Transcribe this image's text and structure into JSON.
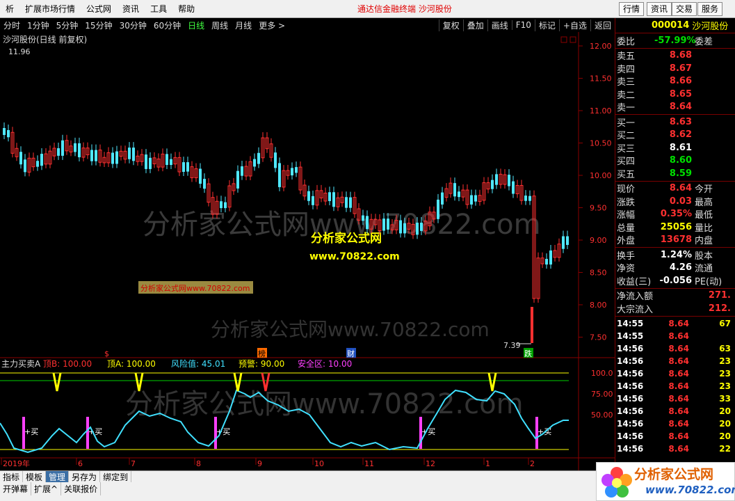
{
  "menu": {
    "items": [
      "析",
      "扩展市场行情",
      "公式网",
      "资讯",
      "工具",
      "帮助"
    ],
    "center": "通达信金融终端   沙河股份",
    "right_buttons": [
      "行情",
      "资讯",
      "交易",
      "服务"
    ]
  },
  "periods": {
    "items": [
      "分时",
      "1分钟",
      "5分钟",
      "15分钟",
      "30分钟",
      "60分钟",
      "日线",
      "周线",
      "月线",
      "更多 >"
    ],
    "active": "日线",
    "tools": [
      "复权",
      "叠加",
      "画线",
      "F10",
      "标记",
      "+自选",
      "返回"
    ]
  },
  "main_chart": {
    "title": "沙河股份(日线 前复权)",
    "high_label": "11.96",
    "low_label": "7.39",
    "y_ticks": [
      "12.00",
      "11.50",
      "11.00",
      "10.50",
      "10.00",
      "9.50",
      "9.00",
      "8.50",
      "8.00",
      "7.50"
    ],
    "markers": [
      "$",
      "榜",
      "财",
      "跌"
    ],
    "watermark_big": "分析家公式网www.70822.com",
    "watermark_small": "分析家公式网www.70822.com",
    "watermark_cn": "分析家公式网",
    "watermark_url": "www.70822.com",
    "colors": {
      "up": "#ff3030",
      "down": "#50e8ff",
      "bg": "#000000"
    }
  },
  "indicator": {
    "name": "主力买卖A",
    "fields": [
      {
        "label": "顶B:",
        "value": "100.00",
        "color": "#ff3030"
      },
      {
        "label": "顶A:",
        "value": "100.00",
        "color": "#ffff00"
      },
      {
        "label": "风险值:",
        "value": "45.01",
        "color": "#40e0ff"
      },
      {
        "label": "预警:",
        "value": "90.00",
        "color": "#ffff00"
      },
      {
        "label": "安全区:",
        "value": "10.00",
        "color": "#ff40ff"
      }
    ],
    "y_ticks": [
      "100.0",
      "75.00",
      "50.00"
    ],
    "buy_label": "+买",
    "buy_marks": 5
  },
  "x_axis": {
    "labels": [
      "2019年",
      "6",
      "7",
      "8",
      "9",
      "10",
      "11",
      "12",
      "1",
      "2"
    ]
  },
  "quote": {
    "code": "000014",
    "name": "沙河股份",
    "weibi_label": "委比",
    "weibi_value": "-57.99%",
    "weicha_label": "委差",
    "asks": [
      {
        "label": "卖五",
        "price": "8.68"
      },
      {
        "label": "卖四",
        "price": "8.67"
      },
      {
        "label": "卖三",
        "price": "8.66"
      },
      {
        "label": "卖二",
        "price": "8.65"
      },
      {
        "label": "卖一",
        "price": "8.64"
      }
    ],
    "bids": [
      {
        "label": "买一",
        "price": "8.63",
        "cls": "red"
      },
      {
        "label": "买二",
        "price": "8.62",
        "cls": "red"
      },
      {
        "label": "买三",
        "price": "8.61",
        "cls": "white"
      },
      {
        "label": "买四",
        "price": "8.60",
        "cls": "green"
      },
      {
        "label": "买五",
        "price": "8.59",
        "cls": "green"
      }
    ],
    "stats1": [
      {
        "label": "现价",
        "value": "8.64",
        "cls": "red",
        "label2": "今开"
      },
      {
        "label": "涨跌",
        "value": "0.03",
        "cls": "red",
        "label2": "最高"
      },
      {
        "label": "涨幅",
        "value": "0.35%",
        "cls": "red",
        "label2": "最低"
      },
      {
        "label": "总量",
        "value": "25056",
        "cls": "yellow",
        "label2": "量比"
      },
      {
        "label": "外盘",
        "value": "13678",
        "cls": "red",
        "label2": "内盘"
      }
    ],
    "stats2": [
      {
        "label": "换手",
        "value": "1.24%",
        "cls": "white",
        "label2": "股本"
      },
      {
        "label": "净资",
        "value": "4.26",
        "cls": "white",
        "label2": "流通"
      },
      {
        "label": "收益(三)",
        "value": "-0.056",
        "cls": "white",
        "label2": "PE(动)"
      }
    ],
    "flows": [
      {
        "label": "净流入额",
        "value": "271."
      },
      {
        "label": "大宗流入",
        "value": "212."
      }
    ],
    "ticks": [
      {
        "t": "14:55",
        "p": "8.64",
        "q": "67"
      },
      {
        "t": "14:55",
        "p": "8.64",
        "q": ""
      },
      {
        "t": "14:56",
        "p": "8.64",
        "q": "63"
      },
      {
        "t": "14:56",
        "p": "8.64",
        "q": "23"
      },
      {
        "t": "14:56",
        "p": "8.64",
        "q": "23"
      },
      {
        "t": "14:56",
        "p": "8.64",
        "q": "23"
      },
      {
        "t": "14:56",
        "p": "8.64",
        "q": "33"
      },
      {
        "t": "14:56",
        "p": "8.64",
        "q": "20"
      },
      {
        "t": "14:56",
        "p": "8.64",
        "q": "20"
      },
      {
        "t": "14:56",
        "p": "8.64",
        "q": "20"
      },
      {
        "t": "14:56",
        "p": "8.64",
        "q": "22"
      }
    ]
  },
  "bottom": {
    "row1": [
      "指标",
      "模板",
      "管理",
      "另存为",
      "绑定到"
    ],
    "row1_active": "管理",
    "row2": [
      "开弹幕",
      "扩展^",
      "关联报价"
    ]
  },
  "logo": {
    "title": "分析家公式网",
    "url": "www.70822.com"
  }
}
